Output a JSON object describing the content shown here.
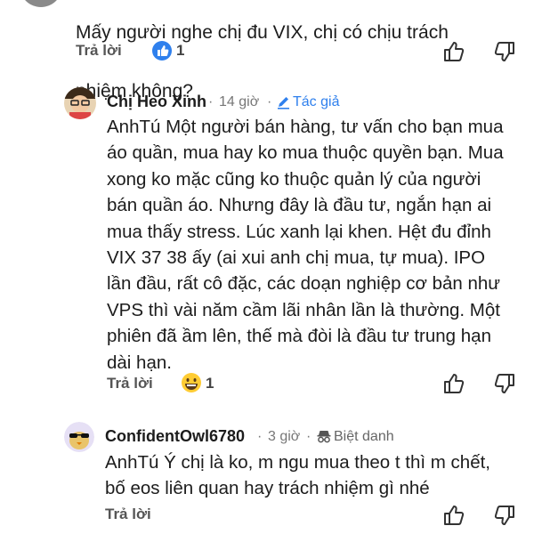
{
  "comments": [
    {
      "text_lines": [
        "Mấy người nghe chị đu VIX, chị có chịu trách",
        "nhiệm không?"
      ],
      "reply_label": "Trả lời",
      "reaction_count": "1",
      "reaction_icon": "like-icon"
    },
    {
      "author": "Chị Heo Xinh",
      "time": "14 giờ",
      "badge": "Tác giả",
      "text_lines": [
        "AnhTú Một người bán hàng, tư vấn cho bạn mua",
        "áo quần, mua hay ko mua thuộc quyền bạn. Mua",
        "xong ko mặc cũng ko thuộc quản lý của người",
        "bán quần áo. Nhưng đây là đầu tư, ngắn hạn ai",
        "mua thấy stress. Lúc xanh lại khen. Hệt đu đỉnh",
        "VIX 37 38 ấy (ai xui anh chị mua, tự mua). IPO",
        "lần đầu, rất cô đặc, các doạn nghiệp cơ bản như",
        "VPS thì vài năm cầm lãi nhân lần là thường. Một",
        "phiên đã ầm lên, thế mà đòi là đầu tư trung hạn",
        "dài hạn."
      ],
      "reply_label": "Trả lời",
      "reaction_count": "1",
      "reaction_icon": "grinning-emoji-icon"
    },
    {
      "author": "ConfidentOwl6780",
      "time": "3 giờ",
      "badge": "Biệt danh",
      "text_lines": [
        "AnhTú Ý chị là ko, m ngu mua theo t thì m chết,",
        "bố eos liên quan hay trách nhiệm gì nhé"
      ],
      "reply_label": "Trả lời"
    }
  ],
  "colors": {
    "accent": "#2f80ed",
    "text": "#1c1c1c",
    "muted": "#777777"
  }
}
